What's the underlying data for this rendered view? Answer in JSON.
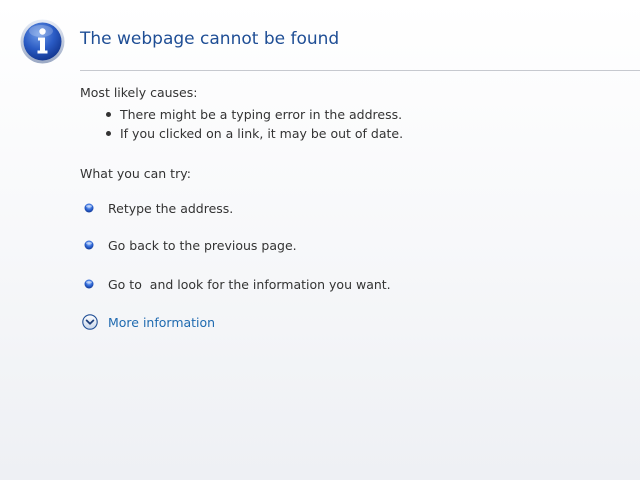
{
  "header": {
    "title": "The webpage cannot be found",
    "icon": "info-icon"
  },
  "causes": {
    "label": "Most likely causes:",
    "items": [
      "There might be a typing error in the address.",
      "If you clicked on a link, it may be out of date."
    ]
  },
  "try": {
    "label": "What you can try:",
    "items": [
      "Retype the address.",
      "Go back to the previous page.",
      "Go to  and look for the information you want."
    ]
  },
  "more_info": {
    "label": "More information",
    "icon": "chevron-down-circle-icon"
  },
  "colors": {
    "title": "#1f4e95",
    "link": "#1f6ab0",
    "text": "#333333",
    "divider": "#c6c9cf"
  }
}
